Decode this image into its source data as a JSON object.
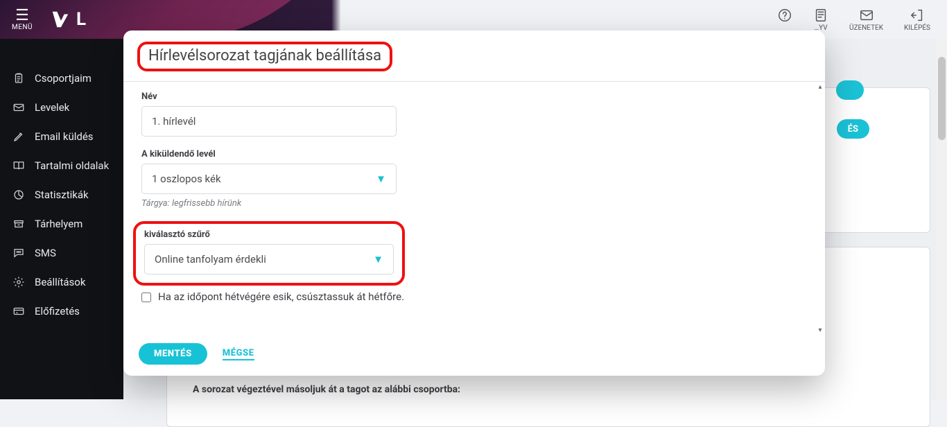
{
  "header": {
    "menu_label": "MENÜ",
    "logo_text": "L",
    "items": [
      {
        "key": "help",
        "label": "",
        "icon": "help-circle-icon"
      },
      {
        "key": "book",
        "label": "…YV",
        "icon": "book-icon"
      },
      {
        "key": "messages",
        "label": "ÜZENETEK",
        "icon": "mail-icon"
      },
      {
        "key": "logout",
        "label": "KILÉPÉS",
        "icon": "logout-icon"
      }
    ]
  },
  "sidebar": {
    "items": [
      {
        "label": "Csoportjaim",
        "icon": "clipboard-icon"
      },
      {
        "label": "Levelek",
        "icon": "mail-icon"
      },
      {
        "label": "Email küldés",
        "icon": "edit-icon"
      },
      {
        "label": "Tartalmi oldalak",
        "icon": "book-open-icon"
      },
      {
        "label": "Statisztikák",
        "icon": "pie-icon"
      },
      {
        "label": "Tárhelyem",
        "icon": "archive-icon"
      },
      {
        "label": "SMS",
        "icon": "speech-icon"
      },
      {
        "label": "Beállítások",
        "icon": "gear-icon"
      },
      {
        "label": "Előfizetés",
        "icon": "card-icon"
      }
    ]
  },
  "background": {
    "button_fragment": "ÉS",
    "copy_text": "A sorozat végeztével másoljuk át a tagot az alábbi csoportba:"
  },
  "modal": {
    "title": "Hírlevélsorozat tagjának beállítása",
    "name_label": "Név",
    "name_value": "1. hírlevél",
    "letter_label": "A kiküldendő levél",
    "letter_value": "1 oszlopos kék",
    "letter_helper": "Tárgya: legfrissebb hírünk",
    "filter_label": "kiválasztó szűrő",
    "filter_value": "Online tanfolyam érdekli",
    "weekend_label": "Ha az időpont hétvégére esik, csúsztassuk át hétfőre.",
    "save": "MENTÉS",
    "cancel": "MÉGSE"
  }
}
